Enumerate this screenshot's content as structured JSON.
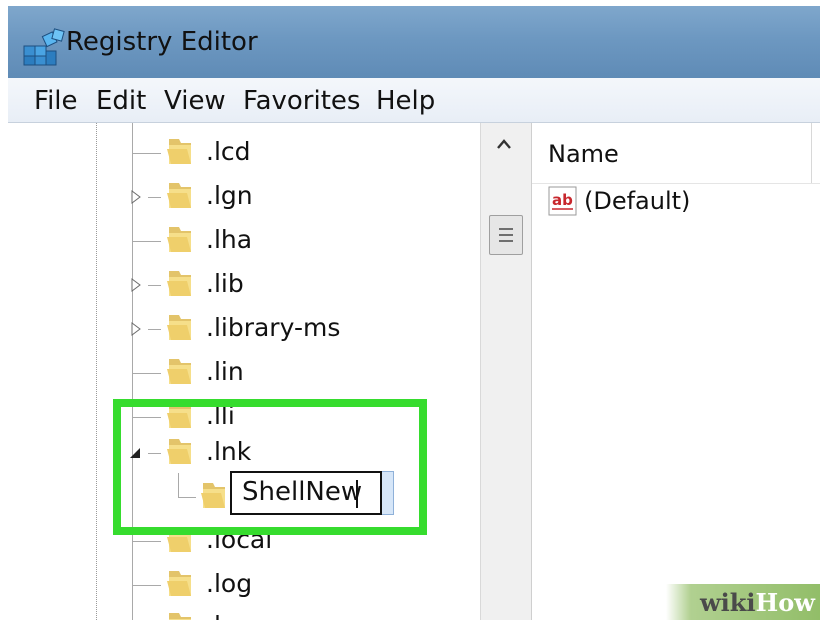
{
  "window": {
    "title": "Registry Editor"
  },
  "menu": [
    "File",
    "Edit",
    "View",
    "Favorites",
    "Help"
  ],
  "tree": {
    "items": [
      {
        "label": ".lcd",
        "has_children": false
      },
      {
        "label": ".lgn",
        "has_children": true
      },
      {
        "label": ".lha",
        "has_children": false
      },
      {
        "label": ".lib",
        "has_children": true
      },
      {
        "label": ".library-ms",
        "has_children": true
      },
      {
        "label": ".lin",
        "has_children": false
      },
      {
        "label": ".lli",
        "has_children": false
      },
      {
        "label": ".lnk",
        "has_children": true,
        "expanded": true
      },
      {
        "label": "ShellNew",
        "child": true,
        "editing": true
      },
      {
        "label": ".local",
        "has_children": false
      },
      {
        "label": ".log",
        "has_children": false
      },
      {
        "label": ".lqn",
        "has_children": false
      }
    ],
    "editing_value": "ShellNew"
  },
  "right_pane": {
    "column_name": "Name",
    "values": [
      {
        "icon": "string-value-icon",
        "icon_text": "ab",
        "name": "(Default)"
      }
    ]
  },
  "watermark": {
    "wiki": "wiki",
    "how": "How"
  },
  "colors": {
    "highlight": "#36dc2e",
    "title_bar": "#6d98c1"
  }
}
